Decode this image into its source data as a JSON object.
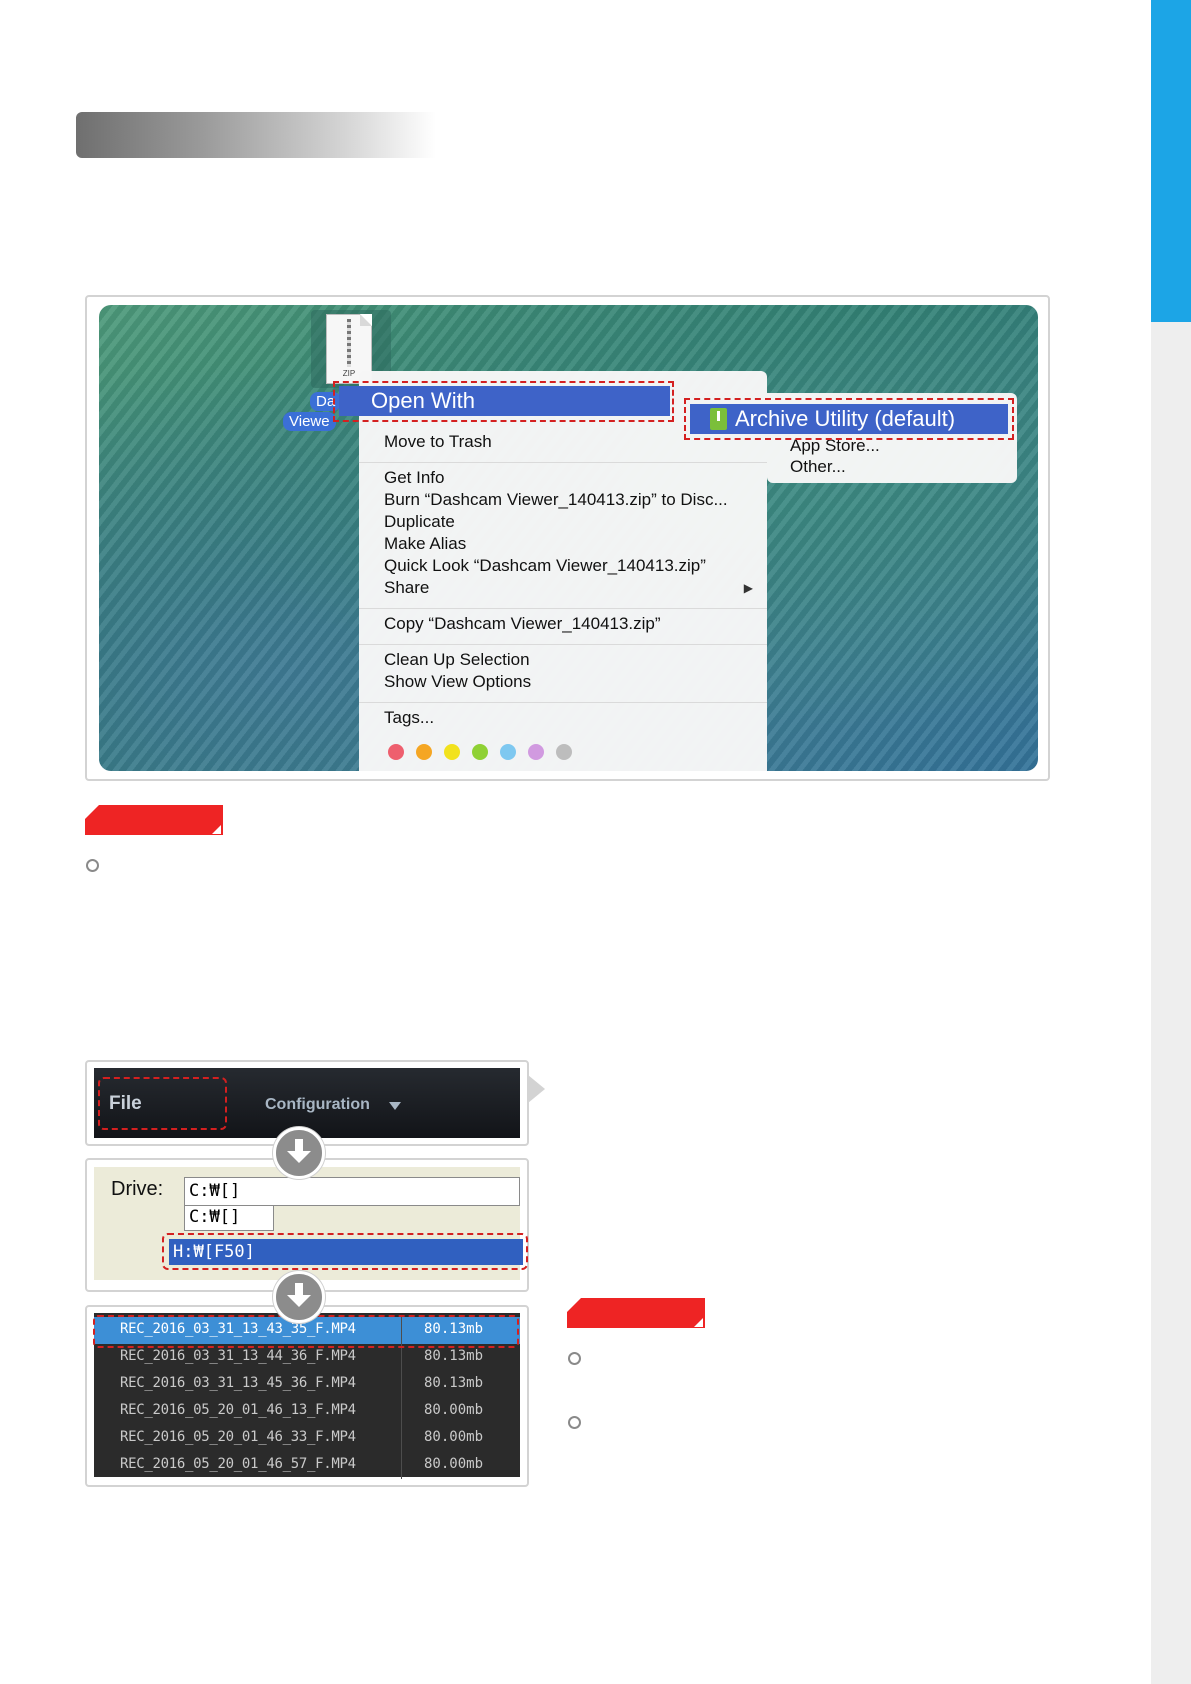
{
  "mac": {
    "file_caption_1": "Da",
    "file_caption_2": "Viewe",
    "zip_label": "ZIP",
    "open_with": "Open With",
    "menu_items": [
      "Move to Trash",
      "Get Info",
      "Burn “Dashcam Viewer_140413.zip” to Disc...",
      "Duplicate",
      "Make Alias",
      "Quick Look “Dashcam Viewer_140413.zip”",
      "Share",
      "Copy “Dashcam Viewer_140413.zip”",
      "Clean Up Selection",
      "Show View Options",
      "Tags..."
    ],
    "share_arrow": "▶",
    "submenu": {
      "archive_utility": "Archive Utility (default)",
      "app_store": "App Store...",
      "other": "Other..."
    },
    "tag_colors": [
      "#ee5f6e",
      "#f5a623",
      "#f2e21d",
      "#8fd134",
      "#7ec8f0",
      "#d19ae0",
      "#bdbdbd"
    ]
  },
  "viewer": {
    "file_menu": "File",
    "configuration_menu": "Configuration",
    "drive_label": "Drive:",
    "drive_current": "C:₩[]",
    "drive_option": "C:₩[]",
    "drive_selected": "H:₩[F50]",
    "files": [
      {
        "name": "REC_2016_03_31_13_43_35_F.MP4",
        "size": "80.13mb",
        "selected": true
      },
      {
        "name": "REC_2016_03_31_13_44_36_F.MP4",
        "size": "80.13mb",
        "selected": false
      },
      {
        "name": "REC_2016_03_31_13_45_36_F.MP4",
        "size": "80.13mb",
        "selected": false
      },
      {
        "name": "REC_2016_05_20_01_46_13_F.MP4",
        "size": "80.00mb",
        "selected": false
      },
      {
        "name": "REC_2016_05_20_01_46_33_F.MP4",
        "size": "80.00mb",
        "selected": false
      },
      {
        "name": "REC_2016_05_20_01_46_57_F.MP4",
        "size": "80.00mb",
        "selected": false
      }
    ]
  },
  "colors": {
    "side_tab": "#1ca5e6",
    "label_red": "#ee2424",
    "highlight_dash": "#d42020",
    "menu_selection": "#3e63c8"
  }
}
